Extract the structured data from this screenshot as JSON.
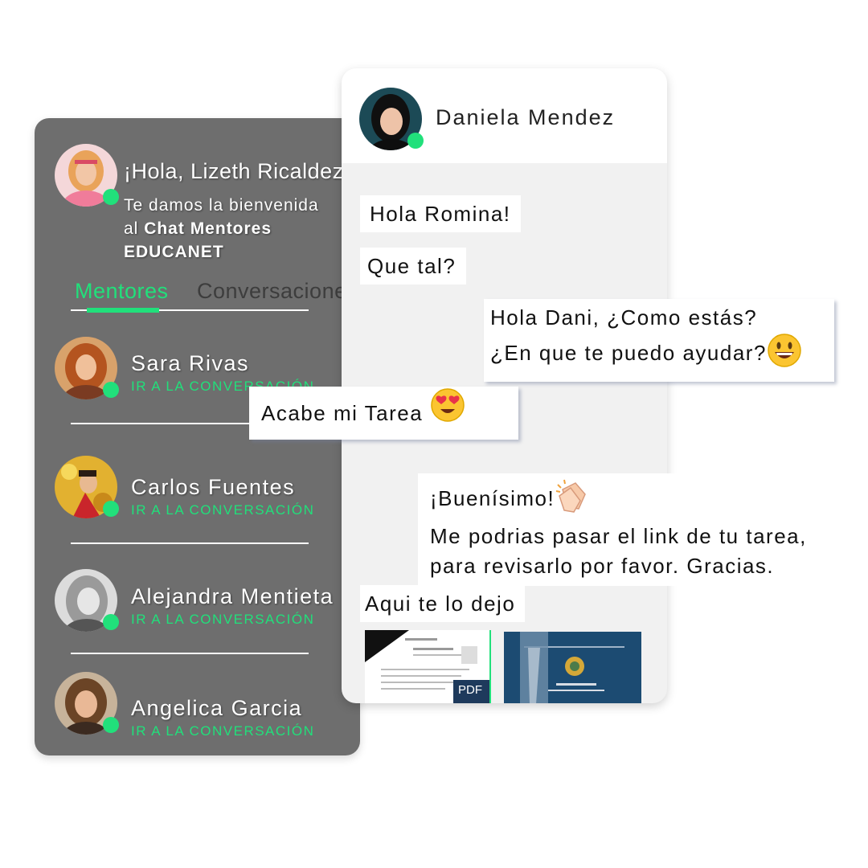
{
  "greeting": {
    "title": "¡Hola, Lizeth Ricaldez",
    "line1": "Te damos la bienvenida",
    "line2_prefix": "al ",
    "line2_bold": "Chat Mentores",
    "line3_bold": "EDUCANET"
  },
  "tabs": {
    "mentores": "Mentores",
    "conversaciones": "Conversaciones"
  },
  "mentors": [
    {
      "name": "Sara Rivas",
      "link": "IR A LA CONVERSACIÓN"
    },
    {
      "name": "Carlos Fuentes",
      "link": "IR A LA CONVERSACIÓN"
    },
    {
      "name": "Alejandra Mentieta",
      "link": "IR A LA CONVERSACIÓN"
    },
    {
      "name": "Angelica Garcia",
      "link": "IR A LA CONVERSACIÓN"
    }
  ],
  "chat": {
    "contact_name": "Daniela Mendez",
    "messages": {
      "m1": "Hola Romina!",
      "m2": "Que tal?",
      "m3_line1": "Hola Dani, ¿Como estás?",
      "m3_line2": "¿En que te puedo ayudar?",
      "m4": "Acabe mi Tarea",
      "m5_line1": "¡Buenísimo!",
      "m5_line2": "Me podrias pasar el link de tu tarea,",
      "m5_line3": "para revisarlo por favor. Gracias.",
      "m6": "Aqui te lo dejo"
    },
    "attachment_label": "PDF"
  },
  "colors": {
    "panel_dark": "#6e6e6e",
    "accent_green": "#21e07b",
    "chat_bg": "#f1f1f1"
  },
  "icons": [
    "smiley-emoji-icon",
    "heart-eyes-emoji-icon",
    "clapping-hands-emoji-icon",
    "pdf-icon"
  ]
}
